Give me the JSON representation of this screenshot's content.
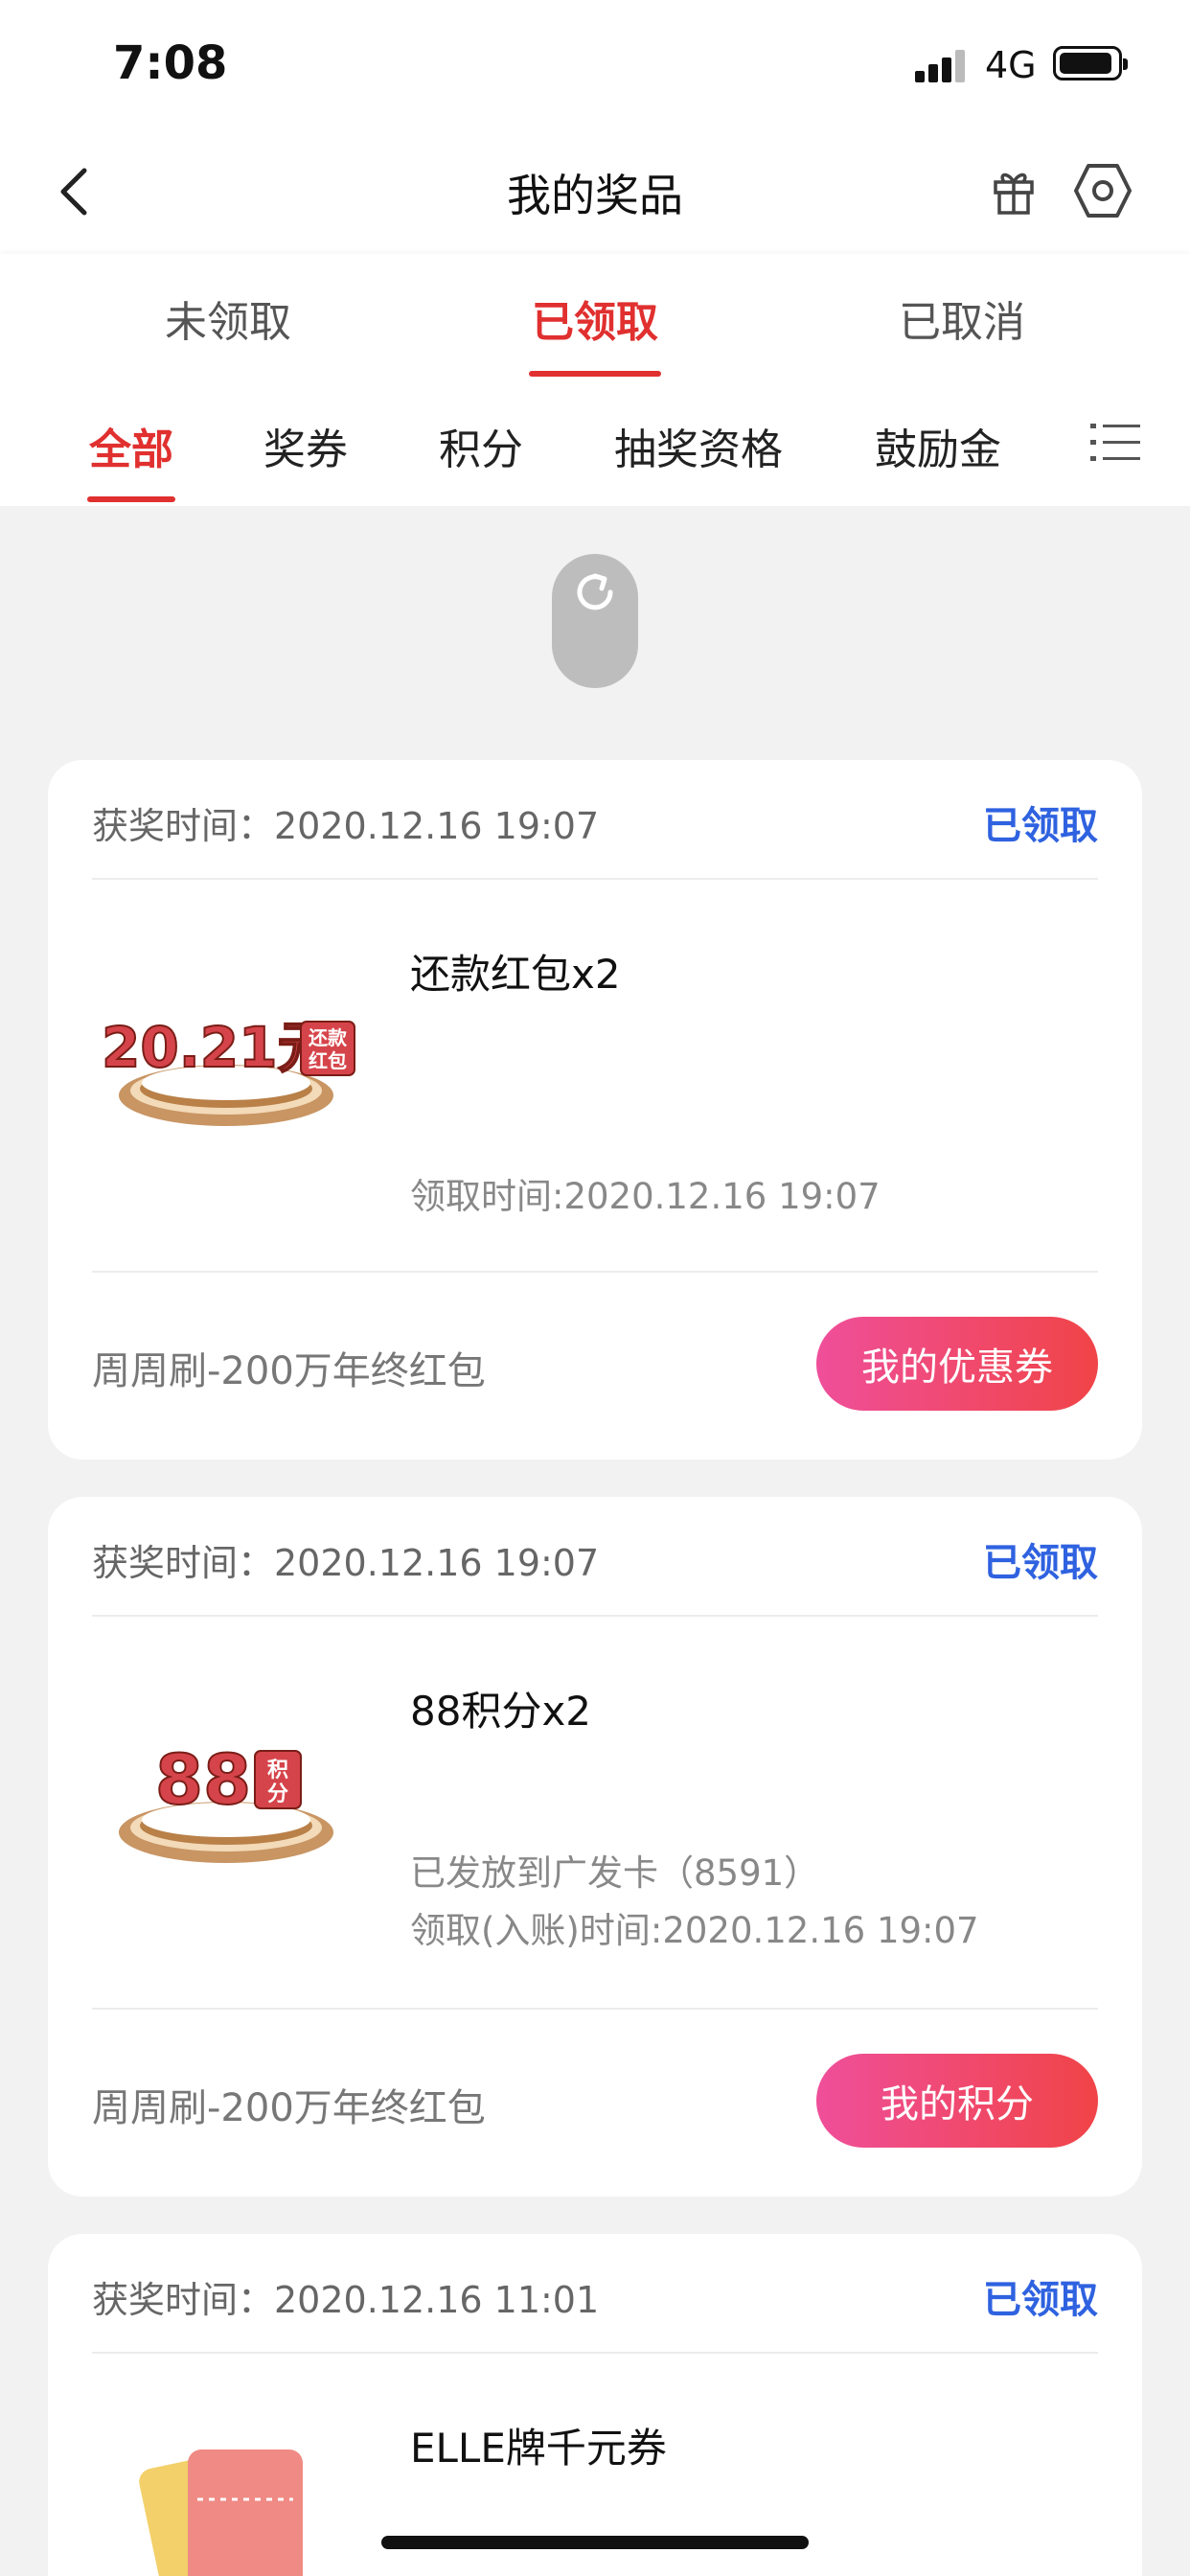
{
  "status_bar": {
    "time": "7:08",
    "network": "4G"
  },
  "nav": {
    "title": "我的奖品"
  },
  "tabs": [
    {
      "label": "未领取"
    },
    {
      "label": "已领取"
    },
    {
      "label": "已取消"
    }
  ],
  "subtabs": [
    {
      "label": "全部"
    },
    {
      "label": "奖券"
    },
    {
      "label": "积分"
    },
    {
      "label": "抽奖资格"
    },
    {
      "label": "鼓励金"
    }
  ],
  "active_tab": "已领取",
  "active_subtab": "全部",
  "cards": [
    {
      "award_time": "获奖时间：2020.12.16 19:07",
      "status": "已领取",
      "image_amount": "20.21元",
      "image_tag_top": "还款",
      "image_tag_bottom": "红包",
      "name": "还款红包x2",
      "line1": "",
      "line2": "领取时间:2020.12.16 19:07",
      "source": "周周刷-200万年终红包",
      "button": "我的优惠券"
    },
    {
      "award_time": "获奖时间：2020.12.16 19:07",
      "status": "已领取",
      "image_amount": "88",
      "image_tag_top": "积",
      "image_tag_bottom": "分",
      "name": "88积分x2",
      "line1": "已发放到广发卡（8591）",
      "line2": "领取(入账)时间:2020.12.16 19:07",
      "source": "周周刷-200万年终红包",
      "button": "我的积分"
    },
    {
      "award_time": "获奖时间：2020.12.16 11:01",
      "status": "已领取",
      "name": "ELLE牌千元券"
    }
  ],
  "colors": {
    "accent_red": "#e0302f",
    "status_blue": "#2f62e0",
    "background": "#f2f2f2"
  }
}
